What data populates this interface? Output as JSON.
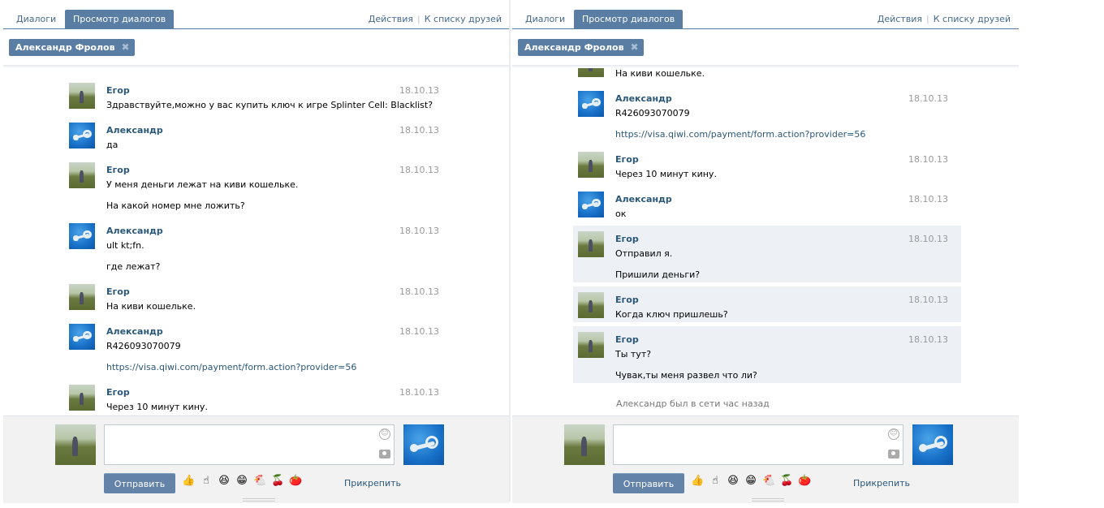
{
  "tabs": {
    "dialogs": "Диалоги",
    "view": "Просмотр диалогов",
    "actions": "Действия",
    "separator": "|",
    "friends": "К списку друзей"
  },
  "chip": {
    "name": "Александр Фролов",
    "close": "✖"
  },
  "left_messages": [
    {
      "author": "Егор",
      "avatar": "field-photo",
      "date": "18.10.13",
      "lines": [
        "Здравствуйте,можно у вас купить ключ к игре Splinter Cell: Blacklist?"
      ]
    },
    {
      "author": "Александр",
      "avatar": "steam-logo",
      "date": "18.10.13",
      "lines": [
        "да"
      ]
    },
    {
      "author": "Егор",
      "avatar": "field-photo",
      "date": "18.10.13",
      "lines": [
        "У меня деньги лежат на киви кошельке.",
        "На какой номер мне ложить?"
      ]
    },
    {
      "author": "Александр",
      "avatar": "steam-logo",
      "date": "18.10.13",
      "lines": [
        "ult kt;fn.",
        "где лежат?"
      ]
    },
    {
      "author": "Егор",
      "avatar": "field-photo",
      "date": "18.10.13",
      "lines": [
        "На киви кошельке."
      ]
    },
    {
      "author": "Александр",
      "avatar": "steam-logo",
      "date": "18.10.13",
      "lines": [
        "R426093070079",
        "https://visa.qiwi.com/payment/form.action?provider=56"
      ]
    },
    {
      "author": "Егор",
      "avatar": "field-photo",
      "date": "18.10.13",
      "lines": [
        "Через 10 минут кину."
      ]
    }
  ],
  "right_messages": [
    {
      "author": "",
      "avatar": "field-photo",
      "date": "",
      "lines": [
        "На киви кошельке."
      ]
    },
    {
      "author": "Александр",
      "avatar": "steam-logo",
      "date": "18.10.13",
      "lines": [
        "R426093070079",
        "https://visa.qiwi.com/payment/form.action?provider=56"
      ]
    },
    {
      "author": "Егор",
      "avatar": "field-photo",
      "date": "18.10.13",
      "lines": [
        "Через 10 минут кину."
      ]
    },
    {
      "author": "Александр",
      "avatar": "steam-logo",
      "date": "18.10.13",
      "lines": [
        "ок"
      ]
    },
    {
      "author": "Егор",
      "avatar": "field-photo",
      "date": "18.10.13",
      "lines": [
        "Отправил я.",
        "Пришили деньги?"
      ],
      "unread": true
    },
    {
      "author": "Егор",
      "avatar": "field-photo",
      "date": "18.10.13",
      "lines": [
        "Когда ключ пришлешь?"
      ],
      "unread": true
    },
    {
      "author": "Егор",
      "avatar": "field-photo",
      "date": "18.10.13",
      "lines": [
        "Ты тут?",
        "Чувак,ты меня развел что ли?"
      ],
      "unread": true
    }
  ],
  "status": "Александр был в сети час назад",
  "composer": {
    "send": "Отправить",
    "attach": "Прикрепить",
    "smile_glyph": "☺",
    "emojis": [
      "👍",
      "☝",
      "😆",
      "😁",
      "🐔",
      "🍒",
      "🍅"
    ]
  },
  "colors": {
    "accent": "#597da3",
    "link": "#2b587a",
    "unread_bg": "#edf1f5"
  }
}
